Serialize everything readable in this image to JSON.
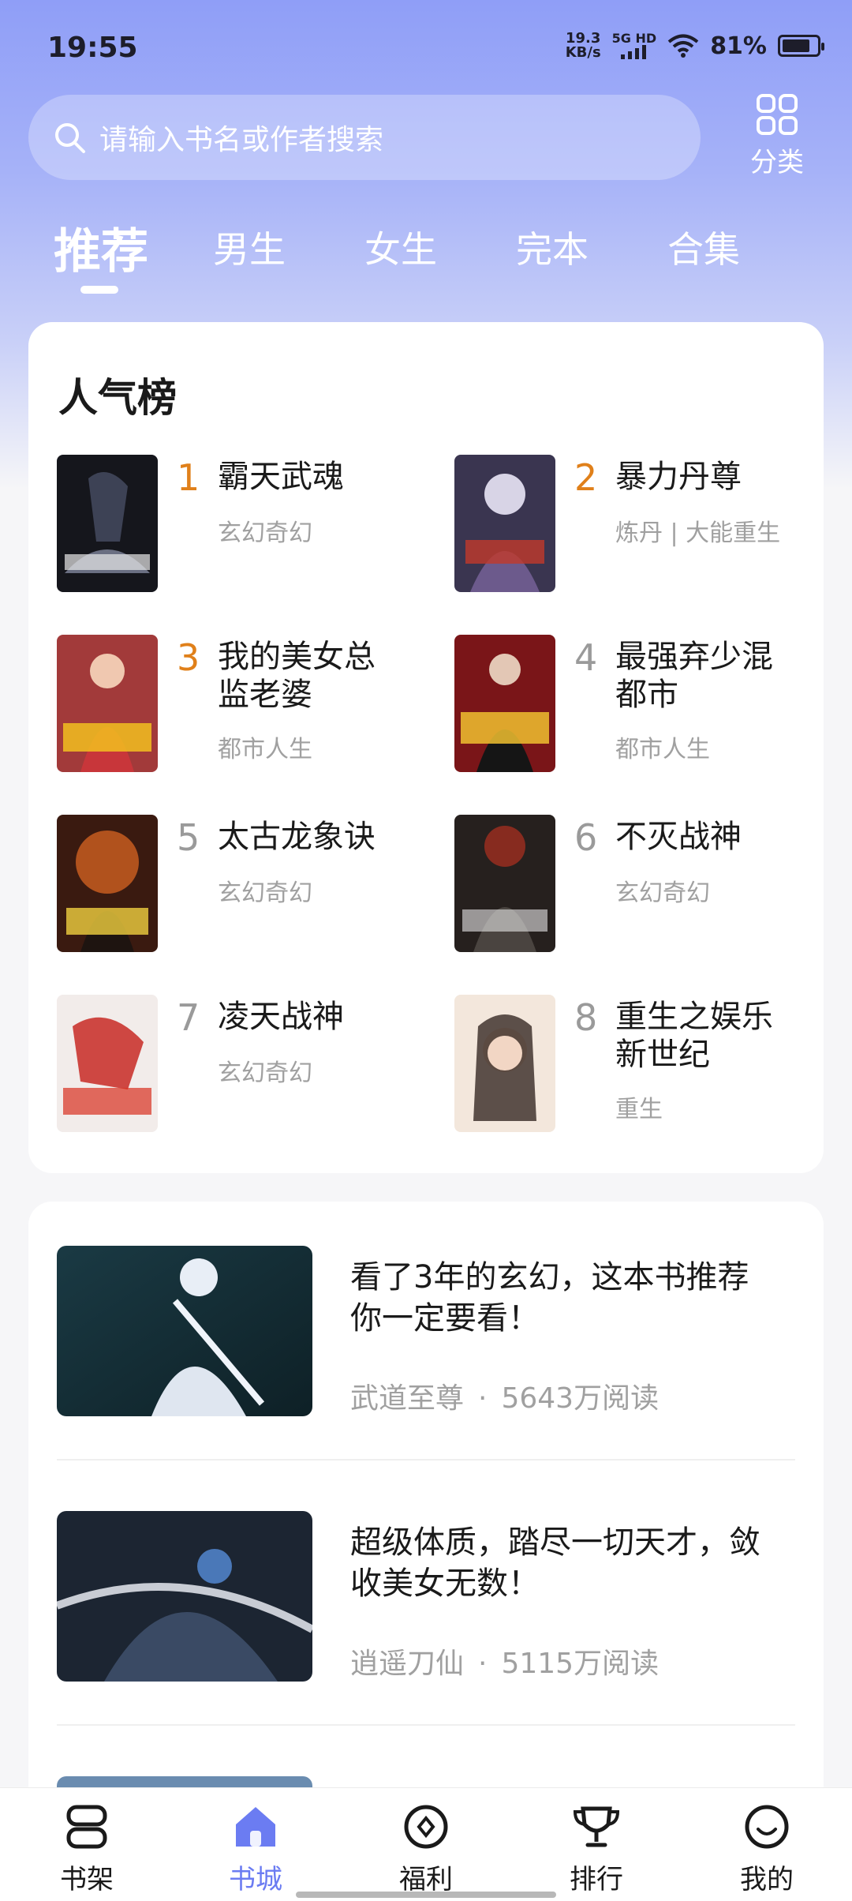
{
  "status_bar": {
    "time": "19:55",
    "net_speed_value": "19.3",
    "net_speed_unit": "KB/s",
    "signal_label": "5G HD",
    "battery_percent": "81%",
    "battery_level": 0.81
  },
  "search": {
    "placeholder": "请输入书名或作者搜索",
    "icon": "search-icon"
  },
  "category": {
    "label": "分类",
    "icon": "grid-icon"
  },
  "tabs": [
    {
      "label": "推荐",
      "active": true
    },
    {
      "label": "男生"
    },
    {
      "label": "女生"
    },
    {
      "label": "完本"
    },
    {
      "label": "合集"
    }
  ],
  "ranking": {
    "title": "人气榜",
    "books": [
      {
        "rank": "1",
        "title_line1": "霸天武魂",
        "title_line2": "",
        "tag": "玄幻奇幻"
      },
      {
        "rank": "2",
        "title_line1": "暴力丹尊",
        "title_line2": "",
        "tag": "炼丹 | 大能重生"
      },
      {
        "rank": "3",
        "title_line1": "我的美女总",
        "title_line2": "监老婆",
        "tag": "都市人生"
      },
      {
        "rank": "4",
        "title_line1": "最强弃少混",
        "title_line2": "都市",
        "tag": "都市人生"
      },
      {
        "rank": "5",
        "title_line1": "太古龙象诀",
        "title_line2": "",
        "tag": "玄幻奇幻"
      },
      {
        "rank": "6",
        "title_line1": "不灭战神",
        "title_line2": "",
        "tag": "玄幻奇幻"
      },
      {
        "rank": "7",
        "title_line1": "凌天战神",
        "title_line2": "",
        "tag": "玄幻奇幻"
      },
      {
        "rank": "8",
        "title_line1": "重生之娱乐",
        "title_line2": "新世纪",
        "tag": "重生"
      }
    ]
  },
  "feed": [
    {
      "title_line1": "看了3年的玄幻，这本书推荐",
      "title_line2": "你一定要看！",
      "book": "武道至尊",
      "reads": "5643万阅读"
    },
    {
      "title_line1": "超级体质，踏尽一切天才，敛",
      "title_line2": "收美女无数！",
      "book": "逍遥刀仙",
      "reads": "5115万阅读"
    }
  ],
  "meta_separator": "·",
  "bottom_nav": [
    {
      "label": "书架",
      "icon": "bookshelf-icon"
    },
    {
      "label": "书城",
      "icon": "home-icon",
      "active": true
    },
    {
      "label": "福利",
      "icon": "coin-icon"
    },
    {
      "label": "排行",
      "icon": "trophy-icon"
    },
    {
      "label": "我的",
      "icon": "smile-icon"
    }
  ],
  "colors": {
    "accent": "#6b7cf2",
    "hot_rank": "#e0801a",
    "muted_text": "#a0a0a0"
  }
}
